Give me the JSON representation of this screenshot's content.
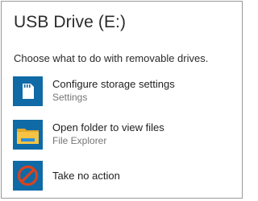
{
  "dialog": {
    "title": "USB Drive (E:)",
    "prompt": "Choose what to do with removable drives."
  },
  "options": [
    {
      "label": "Configure storage settings",
      "sublabel": "Settings",
      "icon": "sd-card-icon"
    },
    {
      "label": "Open folder to view files",
      "sublabel": "File Explorer",
      "icon": "folder-icon"
    },
    {
      "label": "Take no action",
      "icon": "prohibited-icon"
    }
  ],
  "colors": {
    "tile": "#0f6aa6",
    "folder": "#f6c343",
    "prohibited": "#d9431e"
  }
}
